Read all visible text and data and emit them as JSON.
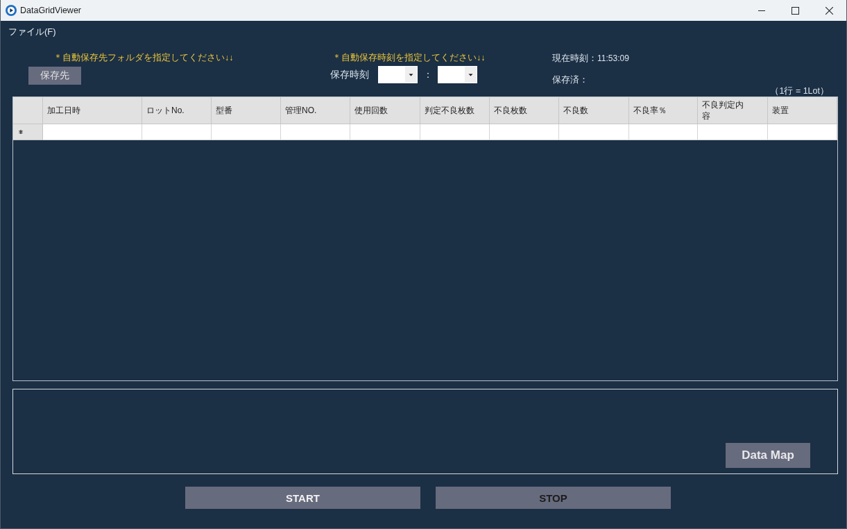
{
  "window": {
    "title": "DataGridViewer"
  },
  "menu_bar": {
    "items": [
      {
        "label": "ファイル(F)"
      }
    ]
  },
  "save_folder": {
    "hint": "＊自動保存先フォルダを指定してください↓↓",
    "button": "保存先"
  },
  "save_time": {
    "hint": "＊自動保存時刻を指定してください↓↓",
    "label": "保存時刻",
    "separator": "：",
    "fields": [
      {
        "kind": "dropdown"
      },
      {
        "kind": "dropdown"
      }
    ]
  },
  "status": {
    "current_time_label": "現在時刻：",
    "current_time": "11:53:09",
    "saved_label": "保存済："
  },
  "row_note": "（1行 = 1Lot）",
  "table": {
    "columns": [
      "加工日時",
      "ロットNo.",
      "型番",
      "管理NO.",
      "使用回数",
      "判定不良枚数",
      "不良枚数",
      "不良数",
      "不良率％",
      "不良判定内容",
      "装置"
    ],
    "new_row": true
  },
  "log_panel": {
    "button": "Data Map"
  },
  "buttons": [
    {
      "label": "START",
      "disabled": false
    },
    {
      "label": "STOP",
      "disabled": true
    }
  ]
}
